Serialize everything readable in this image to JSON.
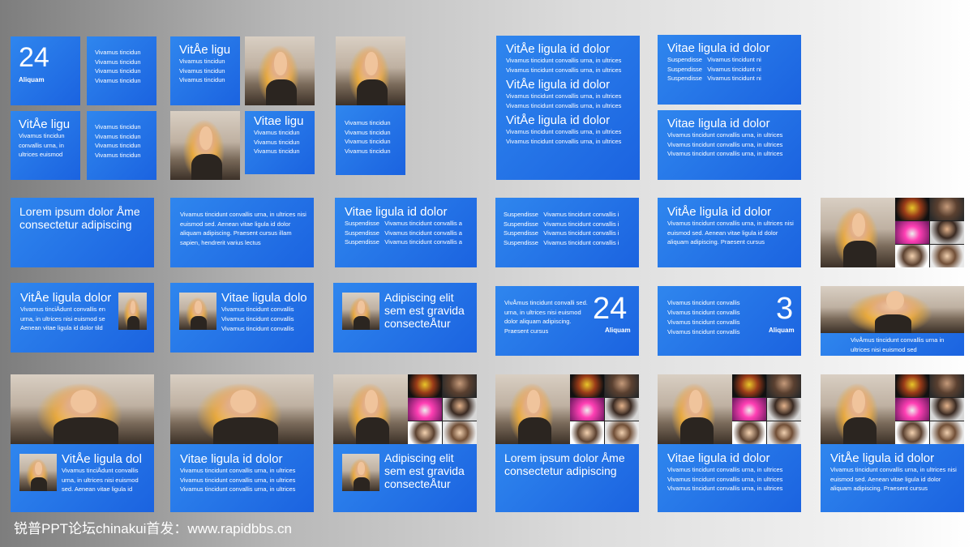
{
  "title_word": "Vitae ligula id dolor",
  "t1": {
    "number": "24",
    "label": "Aliquam"
  },
  "vt": "Vivamus tincidun",
  "vitae_short": "VitÅe ligu",
  "vitae_short2": "Vitae ligu",
  "ultr": "ultrices euismod",
  "conv": "convallis urna, in",
  "vital": "VitÅe ligula id dolor",
  "vit_plain": "Vitae ligula id dolor",
  "l1": "Vivamus tincidunt convallis urna, in ultrices",
  "l2": "Vivamus tincidunt convallis urna, in ultrices",
  "susp_a": "Suspendisse",
  "susp_b": "Vivamus tincidunt ni",
  "lorem1": "Lorem ipsum dolor Åme consectetur adipiscing",
  "para1": "Vivamus tincidunt convallis urna, in ultrices nisi euismod sed. Aenean vitae ligula id dolor aliquam adipiscing. Praesent cursus illam sapien, hendrerit varius lectus",
  "susp_row_b": "Vivamus tincidunt convallis a",
  "susp_row_c": "Vivamus tincidunt convallis i",
  "r2_5_para": "Vivamus tincidunt convallis urna, in ultrices nisi euismod sed. Aenean vitae ligula id dolor aliquam adipiscing. Praesent cursus",
  "r3_1_title": "VitÅe ligula dolor",
  "r3_1_para": "Vivamus tinciÅdunt convallis en urna, in ultrices nisi euismod se Aenean vitae ligula id dolor tild",
  "r3_2_title": "Vitae ligula dolo",
  "r3_2_l": "Vivamus tincidunt convallis",
  "adip": "Adipiscing elit sem est gravida consecteÅtur",
  "r3_4_para": "VivÅmus tincidunt convalli sed. urna, in ultrices nisi euismod dolor aliquam adipiscing. Praesent cursus",
  "r3_4_num": "24",
  "r3_5_l": "Vivamus tincidunt convallis",
  "r3_5_num": "3",
  "r3_6_text": "VivÅmus tincidunt convallis urna in ultrices nisi euismod sed",
  "r4_1_title": "VitÅe ligula dol",
  "r4_1_para": "Vivamus tinciÅdunt convallis urna, in ultrices nisi euismod sed. Aenean vitae ligula id",
  "r4_6_para": "Vivamus tincidunt convallis urna, in ultrices nisi euismod sed. Aenean vitae ligula id dolor aliquam adipiscing. Praesent cursus",
  "lorem2": "Lorem ipsum dolor Åme consectetur adipiscing",
  "footer": "锐普PPT论坛chinakui首发：www.rapidbbs.cn",
  "colors": {
    "tile": "#1f6fe5",
    "tile_light": "#2f86ee"
  }
}
